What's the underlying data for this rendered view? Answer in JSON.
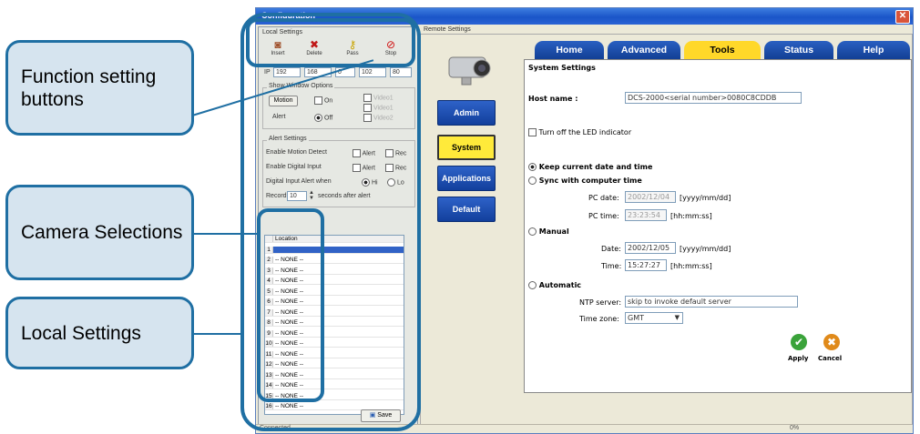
{
  "callouts": {
    "function": "Function setting buttons",
    "camera": "Camera Selections",
    "local": "Local Settings"
  },
  "window": {
    "title": "Configuration",
    "status_left": "Connected",
    "status_right": "0%"
  },
  "local": {
    "group_label": "Local Settings",
    "tools": [
      {
        "label": "Insert",
        "icon": "insert-icon"
      },
      {
        "label": "Delete",
        "icon": "delete-icon"
      },
      {
        "label": "Pass",
        "icon": "key-icon"
      },
      {
        "label": "Stop",
        "icon": "stop-icon"
      }
    ],
    "ip_label": "IP",
    "ip": [
      "192",
      "168",
      "0",
      "102"
    ],
    "port": "80",
    "show_window": {
      "label": "Show Window Options",
      "motion": "Motion",
      "on": "On",
      "off": "Off",
      "alert": "Alert",
      "video1": "Video1",
      "video2": "Video2"
    },
    "alert_settings": {
      "label": "Alert Settings",
      "enable_motion": "Enable Motion Detect",
      "enable_digital": "Enable Digital Input",
      "alert": "Alert",
      "rec": "Rec",
      "digital_when": "Digital Input Alert when",
      "hi": "Hi",
      "lo": "Lo",
      "record": "Record",
      "record_value": "10",
      "seconds_after": "seconds after alert"
    },
    "table": {
      "header": "Location",
      "rows": [
        {
          "n": "1",
          "loc": ""
        },
        {
          "n": "2",
          "loc": "-- NONE --"
        },
        {
          "n": "3",
          "loc": "-- NONE --"
        },
        {
          "n": "4",
          "loc": "-- NONE --"
        },
        {
          "n": "5",
          "loc": "-- NONE --"
        },
        {
          "n": "6",
          "loc": "-- NONE --"
        },
        {
          "n": "7",
          "loc": "-- NONE --"
        },
        {
          "n": "8",
          "loc": "-- NONE --"
        },
        {
          "n": "9",
          "loc": "-- NONE --"
        },
        {
          "n": "10",
          "loc": "-- NONE --"
        },
        {
          "n": "11",
          "loc": "-- NONE --"
        },
        {
          "n": "12",
          "loc": "-- NONE --"
        },
        {
          "n": "13",
          "loc": "-- NONE --"
        },
        {
          "n": "14",
          "loc": "-- NONE --"
        },
        {
          "n": "15",
          "loc": "-- NONE --"
        },
        {
          "n": "16",
          "loc": "-- NONE --"
        }
      ]
    },
    "save": "Save"
  },
  "remote": {
    "label": "Remote Settings",
    "nav": [
      "Admin",
      "System",
      "Applications",
      "Default"
    ],
    "tabs": [
      "Home",
      "Advanced",
      "Tools",
      "Status",
      "Help"
    ],
    "heading": "System Settings",
    "host_label": "Host name :",
    "host_value": "DCS-2000<serial number>0080C8CDDB",
    "led": "Turn off the LED indicator",
    "keep": "Keep current date and time",
    "sync": "Sync with computer time",
    "pc_date_label": "PC date:",
    "pc_date": "2002/12/04",
    "date_fmt": "[yyyy/mm/dd]",
    "pc_time_label": "PC time:",
    "pc_time": "23:23:54",
    "time_fmt": "[hh:mm:ss]",
    "manual": "Manual",
    "date_label": "Date:",
    "date": "2002/12/05",
    "time_label": "Time:",
    "time": "15:27:27",
    "automatic": "Automatic",
    "ntp_label": "NTP server:",
    "ntp": "skip to invoke default server",
    "tz_label": "Time zone:",
    "tz": "GMT",
    "apply": "Apply",
    "cancel": "Cancel"
  }
}
